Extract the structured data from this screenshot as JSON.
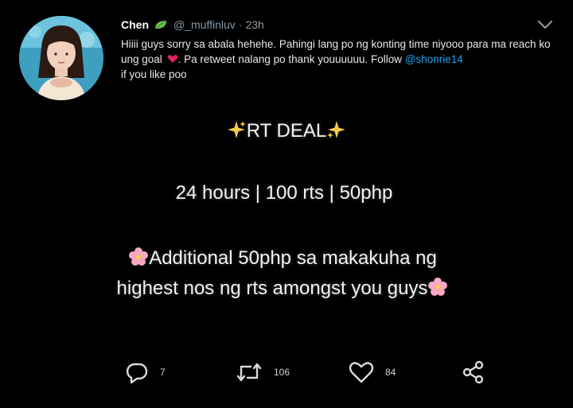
{
  "tweet": {
    "author_name": "Chen",
    "author_handle": "@_muffinluv",
    "separator": "·",
    "time": "23h",
    "text_part1": "Hiiii guys sorry sa abala hehehe. Pahingi lang po ng konting time niyooo para ma reach ko ung goal",
    "text_part2": ". Pa retweet nalang po thank youuuuuu. Follow",
    "mention": "@shonrie14",
    "text_part3": "if you like poo"
  },
  "image_text": {
    "deal_title": "RT DEAL",
    "deal_terms": "24 hours | 100 rts | 50php",
    "additional_line1": "Additional 50php sa makakuha ng",
    "additional_line2": "highest nos ng rts amongst you guys"
  },
  "actions": {
    "reply_count": "7",
    "retweet_count": "106",
    "like_count": "84"
  },
  "colors": {
    "background": "#000000",
    "link": "#1da1f2",
    "muted": "#8899a6",
    "heart": "#e0245e"
  },
  "icons": [
    "leaf-emoji-icon",
    "chevron-down-icon",
    "red-heart-emoji-icon",
    "sparkles-icon",
    "cherry-blossom-icon",
    "reply-icon",
    "retweet-icon",
    "like-icon",
    "share-icon"
  ]
}
